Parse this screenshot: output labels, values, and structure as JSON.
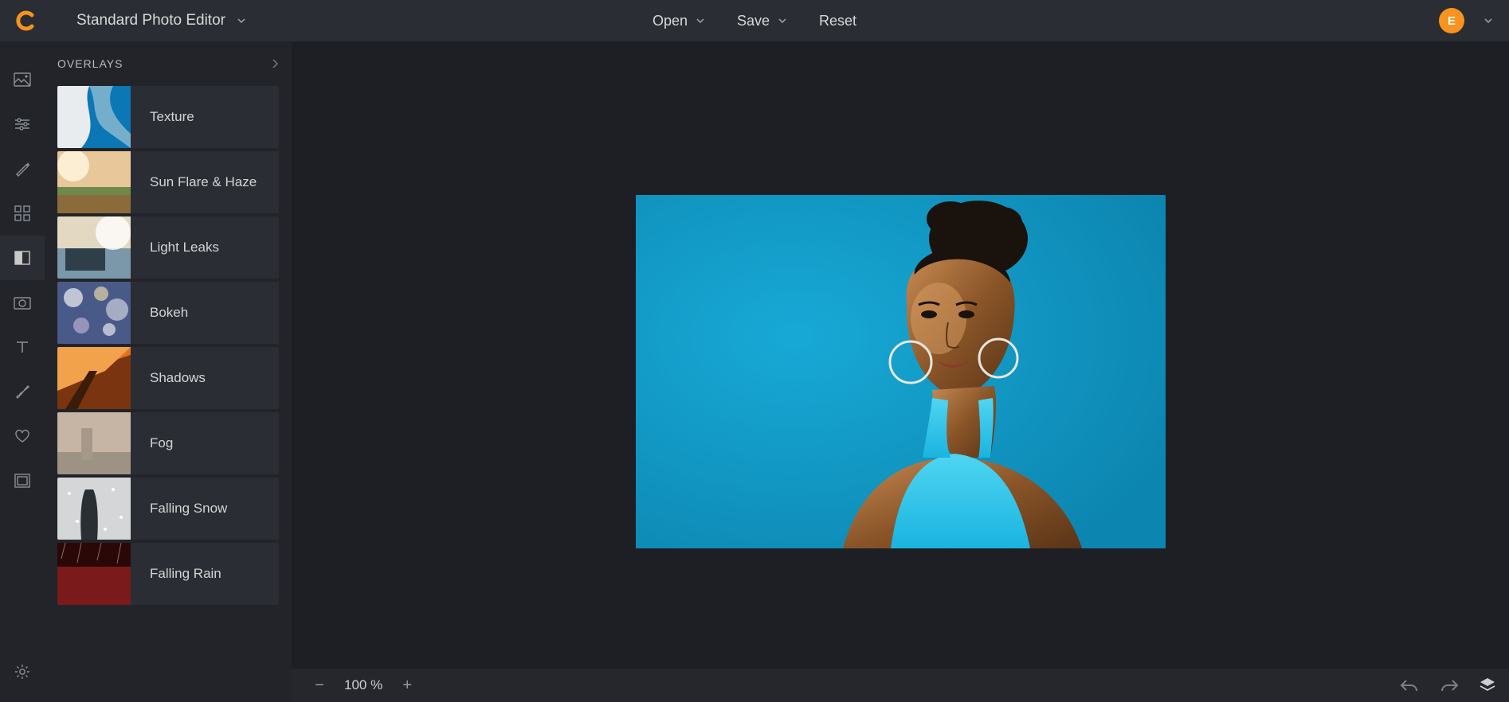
{
  "header": {
    "title": "Standard Photo Editor",
    "open": "Open",
    "save": "Save",
    "reset": "Reset",
    "avatar_letter": "E"
  },
  "panel": {
    "title": "OVERLAYS",
    "items": [
      {
        "label": "Texture"
      },
      {
        "label": "Sun Flare & Haze"
      },
      {
        "label": "Light Leaks"
      },
      {
        "label": "Bokeh"
      },
      {
        "label": "Shadows"
      },
      {
        "label": "Fog"
      },
      {
        "label": "Falling Snow"
      },
      {
        "label": "Falling Rain"
      }
    ]
  },
  "rail": {
    "items": [
      {
        "name": "image-icon"
      },
      {
        "name": "sliders-icon"
      },
      {
        "name": "magic-wand-icon"
      },
      {
        "name": "grid-icon"
      },
      {
        "name": "overlays-icon",
        "active": true
      },
      {
        "name": "camera-icon"
      },
      {
        "name": "text-icon"
      },
      {
        "name": "brush-icon"
      },
      {
        "name": "heart-icon"
      },
      {
        "name": "frame-icon"
      }
    ],
    "bottom": {
      "name": "gear-icon"
    }
  },
  "bottombar": {
    "zoom": "100 %"
  },
  "colors": {
    "accent": "#f7931e",
    "bg": "#1d1f24",
    "panel": "#222429",
    "item": "#2a2d34"
  }
}
